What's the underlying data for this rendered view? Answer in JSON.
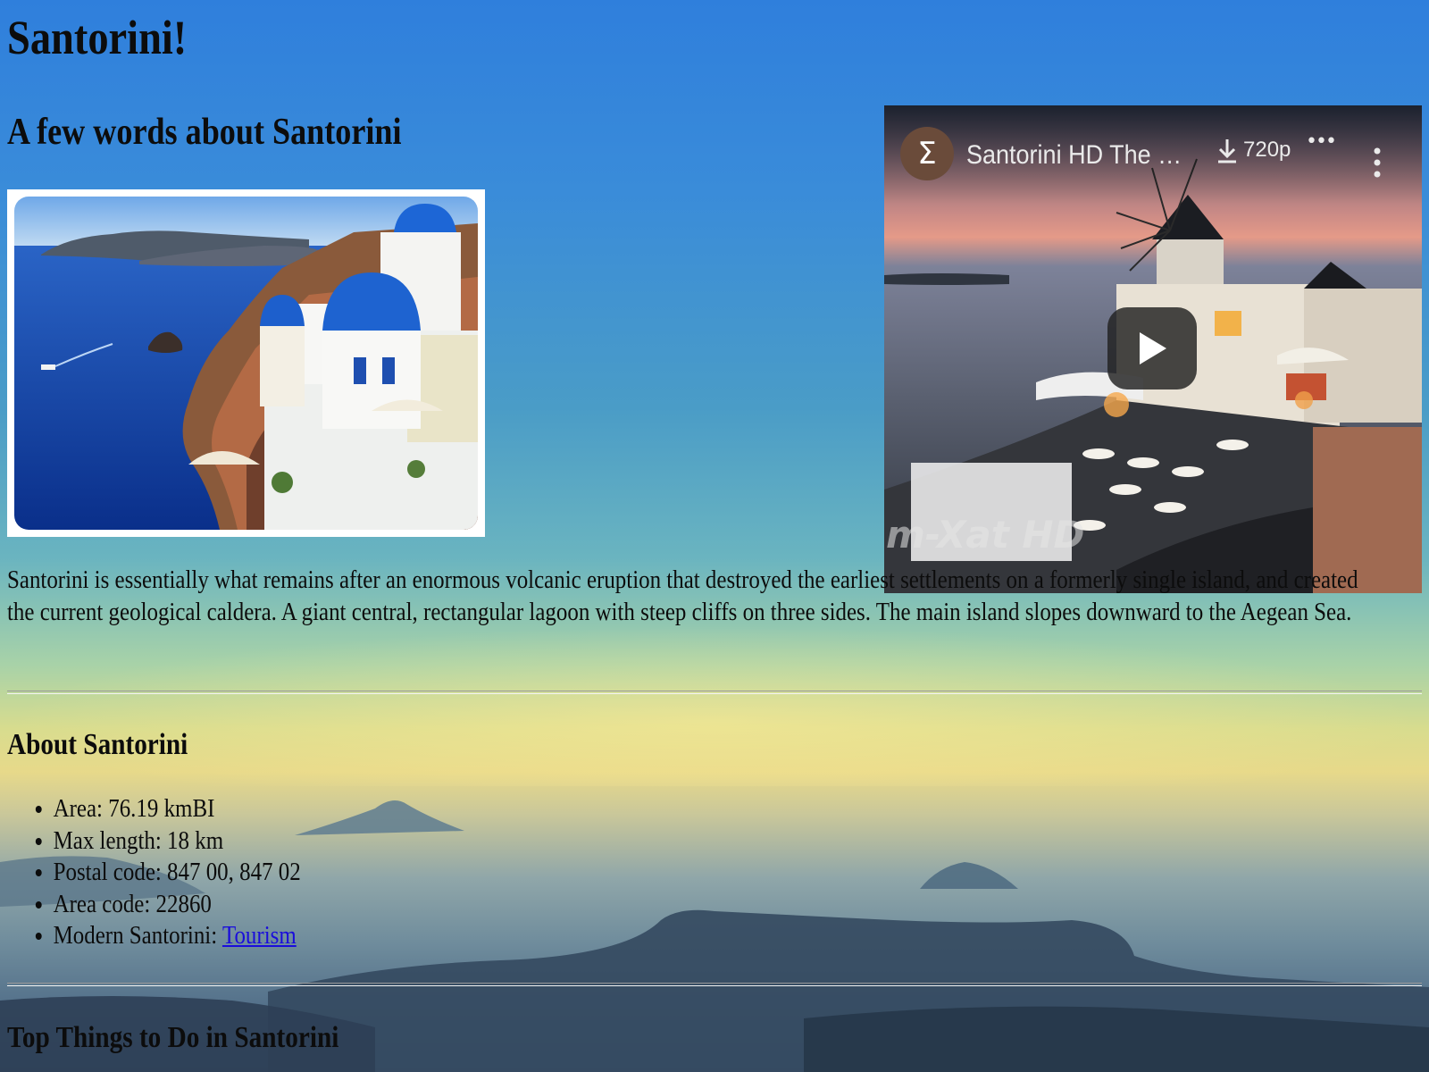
{
  "page": {
    "title": "Santorini!",
    "lead_heading": "A few words about Santorini",
    "intro_paragraph": "Santorini is essentially what remains after an enormous volcanic eruption that destroyed the earliest settlements on a formerly single island, and created the current geological caldera. A giant central, rectangular lagoon with steep cliffs on three sides. The main island slopes downward to the Aegean Sea."
  },
  "video": {
    "channel_initial": "Σ",
    "title": "Santorini HD The be...",
    "quality": "720p",
    "more_horizontal": "•••",
    "watermark": "m-Xat HD",
    "icons": [
      "download-icon",
      "more-horizontal-icon",
      "more-vertical-icon",
      "play-icon"
    ]
  },
  "about": {
    "heading": "About Santorini",
    "facts": [
      {
        "label": "Area: 76.19 kmВІ"
      },
      {
        "label": "Max length: 18 km"
      },
      {
        "label": "Postal code: 847 00, 847 02"
      },
      {
        "label": "Area code: 22860"
      },
      {
        "label": "Modern Santorini: ",
        "link_text": "Tourism"
      }
    ]
  },
  "top_things": {
    "heading": "Top Things to Do in Santorini"
  },
  "colors": {
    "link": "#1a0ddb",
    "text": "#0c0c0c",
    "sky_top": "#2f7fdc",
    "horizon": "#e7d98a",
    "sea_bottom": "#3d5775"
  }
}
